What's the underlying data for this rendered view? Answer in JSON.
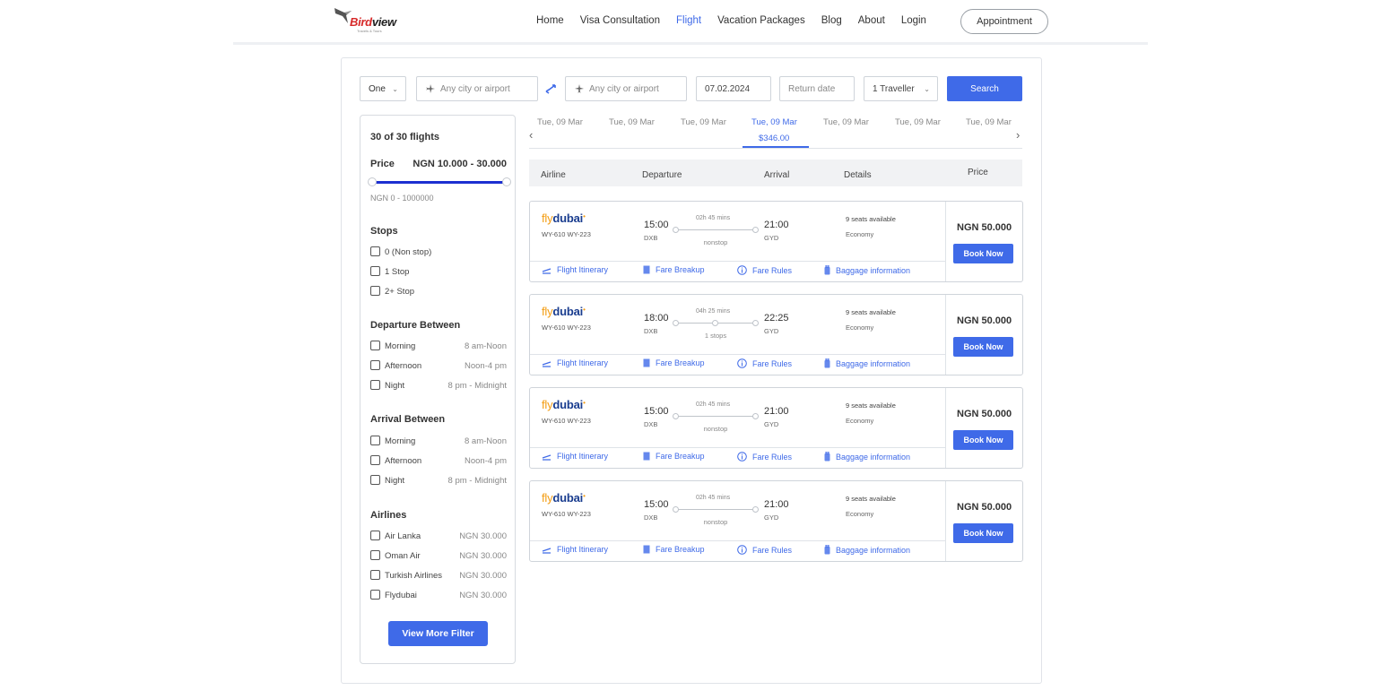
{
  "header": {
    "logo_text_red": "Bird",
    "logo_text_dark": "view",
    "logo_tagline": "Travels & Tours",
    "nav": [
      {
        "label": "Home",
        "active": false
      },
      {
        "label": "Visa Consultation",
        "active": false
      },
      {
        "label": "Flight",
        "active": true
      },
      {
        "label": "Vacation Packages",
        "active": false
      },
      {
        "label": "Blog",
        "active": false
      },
      {
        "label": "About",
        "active": false
      },
      {
        "label": "Login",
        "active": false
      }
    ],
    "appointment_label": "Appointment"
  },
  "search": {
    "trip_type": "One",
    "from_placeholder": "Any city or airport",
    "to_placeholder": "Any city or airport",
    "depart_date": "07.02.2024",
    "return_placeholder": "Return date",
    "travellers": "1 Traveller",
    "search_label": "Search"
  },
  "filters": {
    "count": "30 of 30 flights",
    "price_label": "Price",
    "price_value": "NGN 10.000 - 30.000",
    "price_range": "NGN 0  -  1000000",
    "stops_title": "Stops",
    "stops": [
      "0 (Non stop)",
      "1 Stop",
      "2+ Stop"
    ],
    "departure_title": "Departure Between",
    "departure": [
      {
        "label": "Morning",
        "range": "8 am-Noon"
      },
      {
        "label": "Afternoon",
        "range": "Noon-4 pm"
      },
      {
        "label": "Night",
        "range": "8 pm - Midnight"
      }
    ],
    "arrival_title": "Arrival Between",
    "arrival": [
      {
        "label": "Morning",
        "range": "8 am-Noon"
      },
      {
        "label": "Afternoon",
        "range": "Noon-4 pm"
      },
      {
        "label": "Night",
        "range": "8 pm - Midnight"
      }
    ],
    "airlines_title": "Airlines",
    "airlines": [
      {
        "label": "Air Lanka",
        "price": "NGN 30.000"
      },
      {
        "label": "Oman Air",
        "price": "NGN 30.000"
      },
      {
        "label": "Turkish Airlines",
        "price": "NGN 30.000"
      },
      {
        "label": "Flydubai",
        "price": "NGN 30.000"
      }
    ],
    "more_label": "View More Filter"
  },
  "dates": {
    "tabs": [
      "Tue, 09 Mar",
      "Tue, 09 Mar",
      "Tue, 09 Mar",
      "Tue, 09 Mar",
      "Tue, 09 Mar",
      "Tue, 09 Mar",
      "Tue, 09 Mar"
    ],
    "active_index": 3,
    "active_price": "$346.00",
    "prev_icon": "‹",
    "next_icon": "›"
  },
  "columns": {
    "airline": "Airline",
    "departure": "Departure",
    "arrival": "Arrival",
    "details": "Details",
    "price": "Price"
  },
  "flights": [
    {
      "logo_fly": "fly",
      "logo_dubai": "dubai",
      "number": "WY-610 WY-223",
      "dep_time": "15:00",
      "dep_code": "DXB",
      "duration": "02h 45 mins",
      "stops": "nonstop",
      "arr_time": "21:00",
      "arr_code": "GYD",
      "seats": "9 seats available",
      "cabin": "Economy",
      "price": "NGN 50.000",
      "book": "Book Now",
      "links": [
        "Flight Itinerary",
        "Fare Breakup",
        "Fare Rules",
        "Baggage information"
      ]
    },
    {
      "logo_fly": "fly",
      "logo_dubai": "dubai",
      "number": "WY-610 WY-223",
      "dep_time": "18:00",
      "dep_code": "DXB",
      "duration": "04h 25 mins",
      "stops": "1 stops",
      "arr_time": "22:25",
      "arr_code": "GYD",
      "seats": "9 seats available",
      "cabin": "Economy",
      "price": "NGN 50.000",
      "book": "Book Now",
      "links": [
        "Flight Itinerary",
        "Fare Breakup",
        "Fare Rules",
        "Baggage information"
      ]
    },
    {
      "logo_fly": "fly",
      "logo_dubai": "dubai",
      "number": "WY-610 WY-223",
      "dep_time": "15:00",
      "dep_code": "DXB",
      "duration": "02h 45 mins",
      "stops": "nonstop",
      "arr_time": "21:00",
      "arr_code": "GYD",
      "seats": "9 seats available",
      "cabin": "Economy",
      "price": "NGN 50.000",
      "book": "Book Now",
      "links": [
        "Flight Itinerary",
        "Fare Breakup",
        "Fare Rules",
        "Baggage information"
      ]
    },
    {
      "logo_fly": "fly",
      "logo_dubai": "dubai",
      "number": "WY-610 WY-223",
      "dep_time": "15:00",
      "dep_code": "DXB",
      "duration": "02h 45 mins",
      "stops": "nonstop",
      "arr_time": "21:00",
      "arr_code": "GYD",
      "seats": "9 seats available",
      "cabin": "Economy",
      "price": "NGN 50.000",
      "book": "Book Now",
      "links": [
        "Flight Itinerary",
        "Fare Breakup",
        "Fare Rules",
        "Baggage information"
      ]
    }
  ],
  "colors": {
    "accent": "#3f6ae8",
    "slider": "#1c2fd1",
    "logo_red": "#d62828",
    "flydubai_orange": "#f39c12",
    "flydubai_navy": "#1a3d8f"
  }
}
